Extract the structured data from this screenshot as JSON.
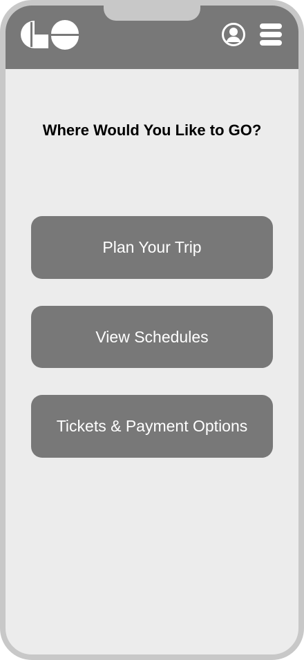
{
  "header": {
    "logo_name": "go-logo",
    "profile_icon": "user-circle-icon",
    "menu_icon": "hamburger-menu-icon"
  },
  "main": {
    "title": "Where Would You Like to GO?",
    "buttons": [
      {
        "label": "Plan Your Trip"
      },
      {
        "label": "View Schedules"
      },
      {
        "label": "Tickets & Payment Options"
      }
    ]
  },
  "colors": {
    "header_bg": "#787878",
    "screen_bg": "#ececec",
    "frame": "#c8c8c8",
    "button_bg": "#787878",
    "button_text": "#ffffff",
    "title_text": "#000000"
  }
}
